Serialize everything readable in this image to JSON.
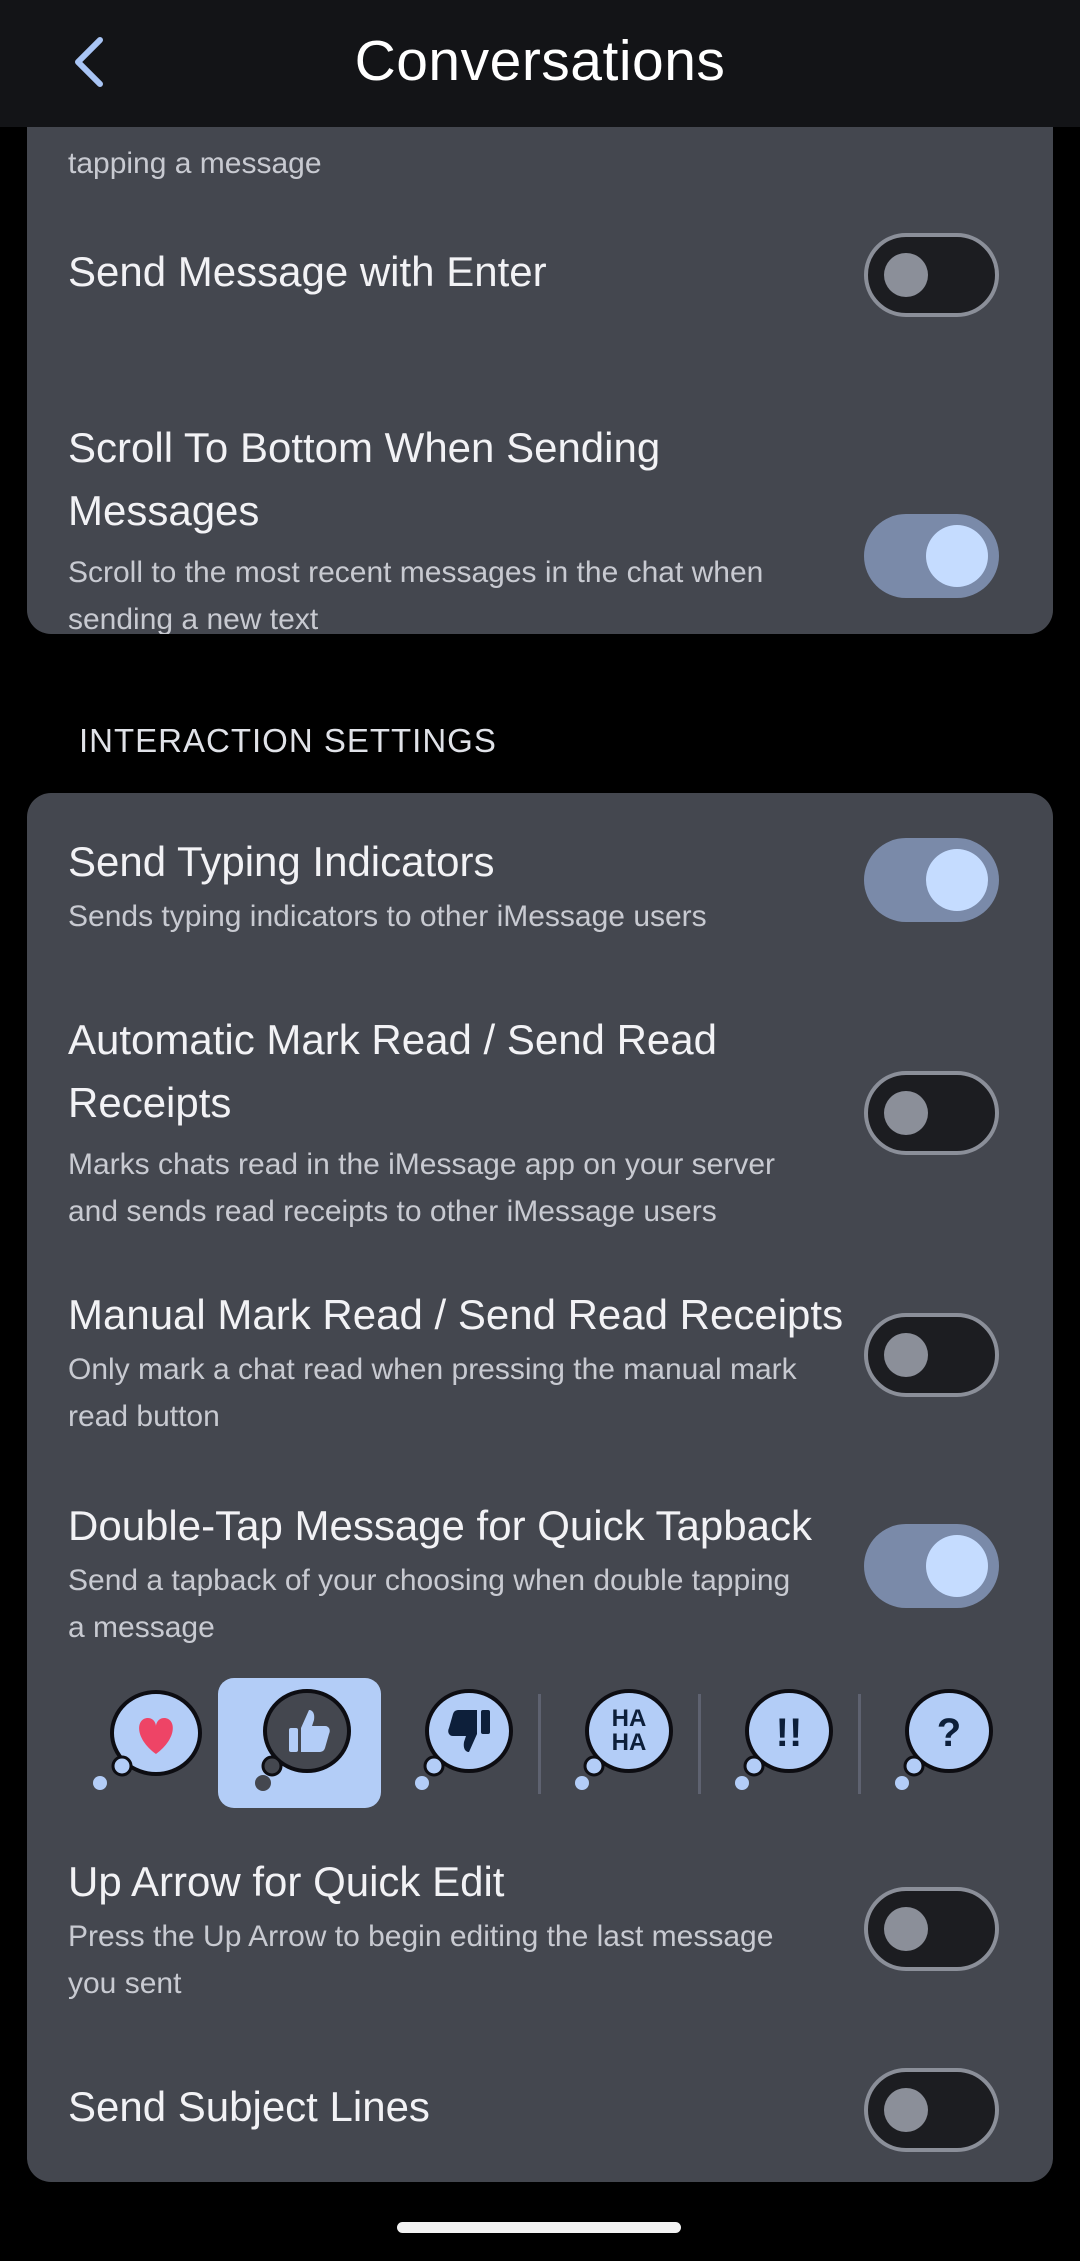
{
  "header": {
    "title": "Conversations"
  },
  "top_section": {
    "partial_item": {
      "subtitle_tail": "tapping a message"
    },
    "items": [
      {
        "label": "Send Message with Enter",
        "subtitle": "",
        "enabled": false
      },
      {
        "label_line1": "Scroll To Bottom When Sending",
        "label_line2": "Messages",
        "subtitle_line1": "Scroll to the most recent messages in the chat when",
        "subtitle_line2": "sending a new text",
        "enabled": true
      }
    ]
  },
  "interaction_section": {
    "heading": "INTERACTION SETTINGS",
    "typing": {
      "label": "Send Typing Indicators",
      "subtitle": "Sends typing indicators to other iMessage users",
      "enabled": true
    },
    "auto_read": {
      "label_line1": "Automatic Mark Read / Send Read",
      "label_line2": "Receipts",
      "subtitle_line1": "Marks chats read in the iMessage app on your server",
      "subtitle_line2": "and sends read receipts to other iMessage users",
      "enabled": false
    },
    "manual_read": {
      "label": "Manual Mark Read / Send Read Receipts",
      "subtitle_line1": "Only mark a chat read when pressing the manual mark",
      "subtitle_line2": "read button",
      "enabled": false
    },
    "double_tap": {
      "label": "Double-Tap Message for Quick Tapback",
      "subtitle_line1": "Send a tapback of your choosing when double tapping",
      "subtitle_line2": "a message",
      "enabled": true
    },
    "tapbacks": {
      "selected": "like",
      "options": [
        "love",
        "like",
        "dislike",
        "laugh",
        "emphasize",
        "question"
      ],
      "laugh_glyph_top": "HA",
      "laugh_glyph_bottom": "HA",
      "emphasize_glyph": "!!",
      "question_glyph": "?"
    },
    "up_arrow": {
      "label": "Up Arrow for Quick Edit",
      "subtitle_line1": "Press the Up Arrow to begin editing the last message",
      "subtitle_line2": "you sent",
      "enabled": false
    },
    "subject": {
      "label": "Send Subject Lines",
      "enabled": false
    }
  },
  "colors": {
    "background": "#000000",
    "header": "#131417",
    "card": "#44474f",
    "accent": "#c5dcff",
    "toggle_on_track": "#7a8aa9",
    "love_heart": "#ee4466"
  }
}
